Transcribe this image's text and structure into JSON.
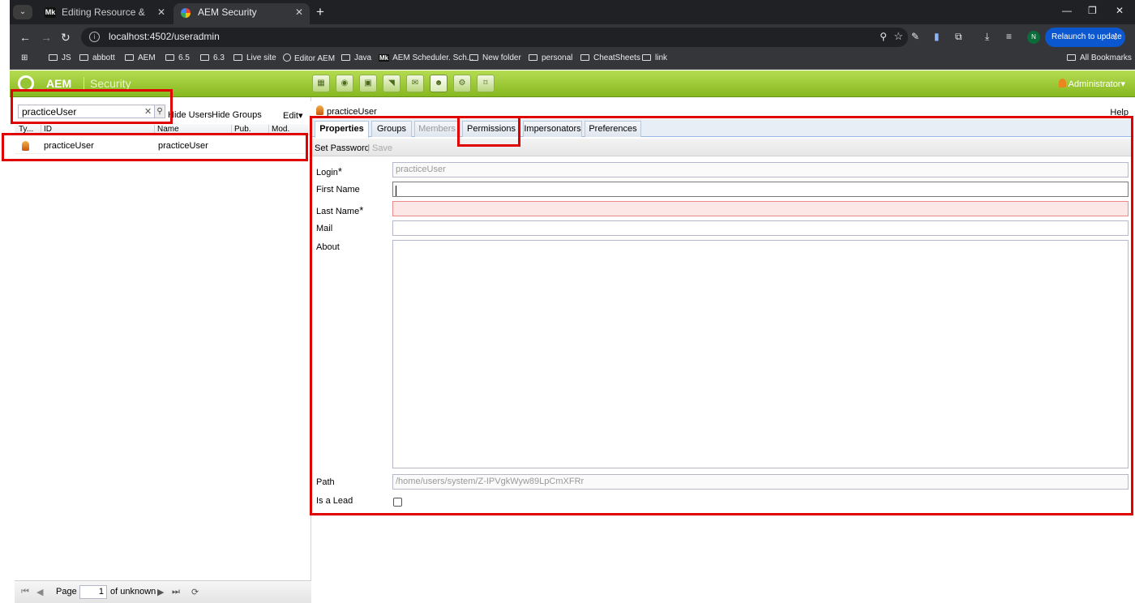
{
  "browser": {
    "tabs": [
      {
        "label": "Editing Resource & Resource R",
        "favicon": "Mk"
      },
      {
        "label": "AEM Security",
        "favicon": "google-color-icon"
      }
    ],
    "url": "localhost:4502/useradmin",
    "relaunch_label": "Relaunch to update",
    "profile_initial": "N",
    "bookmarks": [
      {
        "label": "JS",
        "icon": "folder-icon"
      },
      {
        "label": "abbott",
        "icon": "folder-icon"
      },
      {
        "label": "AEM",
        "icon": "folder-icon"
      },
      {
        "label": "6.5",
        "icon": "folder-icon"
      },
      {
        "label": "6.3",
        "icon": "folder-icon"
      },
      {
        "label": "Live site",
        "icon": "folder-icon"
      },
      {
        "label": "Editor AEM",
        "icon": "globe-icon"
      },
      {
        "label": "Java",
        "icon": "folder-icon"
      },
      {
        "label": "AEM Scheduler. Sch...",
        "icon": "mk-icon"
      },
      {
        "label": "New folder",
        "icon": "folder-icon"
      },
      {
        "label": "personal",
        "icon": "folder-icon"
      },
      {
        "label": "CheatSheets",
        "icon": "folder-icon"
      },
      {
        "label": "link",
        "icon": "folder-icon"
      }
    ],
    "all_bookmarks": "All Bookmarks"
  },
  "aem": {
    "product": "AEM",
    "console": "Security",
    "user_menu": "Administrator"
  },
  "left": {
    "search_value": "practiceUser",
    "hide_users": "Hide Users",
    "hide_groups": "Hide Groups",
    "edit": "Edit",
    "columns": {
      "type": "Ty...",
      "id": "ID",
      "name": "Name",
      "pub": "Pub.",
      "mod": "Mod."
    },
    "rows": [
      {
        "id": "practiceUser",
        "name": "practiceUser"
      }
    ],
    "paging": {
      "page_label": "Page",
      "page_value": "1",
      "of_label": "of unknown"
    }
  },
  "right": {
    "title": "practiceUser",
    "help": "Help",
    "tabs": [
      {
        "label": "Properties",
        "state": "active"
      },
      {
        "label": "Groups",
        "state": "normal"
      },
      {
        "label": "Members",
        "state": "disabled"
      },
      {
        "label": "Permissions",
        "state": "normal"
      },
      {
        "label": "Impersonators",
        "state": "normal"
      },
      {
        "label": "Preferences",
        "state": "normal"
      }
    ],
    "toolbar": {
      "set_password": "Set Password",
      "save": "Save"
    },
    "fields": {
      "login_label": "Login",
      "login_value": "practiceUser",
      "first_name_label": "First Name",
      "last_name_label": "Last Name",
      "mail_label": "Mail",
      "about_label": "About",
      "path_label": "Path",
      "path_value": "/home/users/system/Z-IPVgkWyw89LpCmXFRr",
      "lead_label": "Is a Lead",
      "required_mark": "*"
    }
  },
  "annotation_color": "#e00000"
}
